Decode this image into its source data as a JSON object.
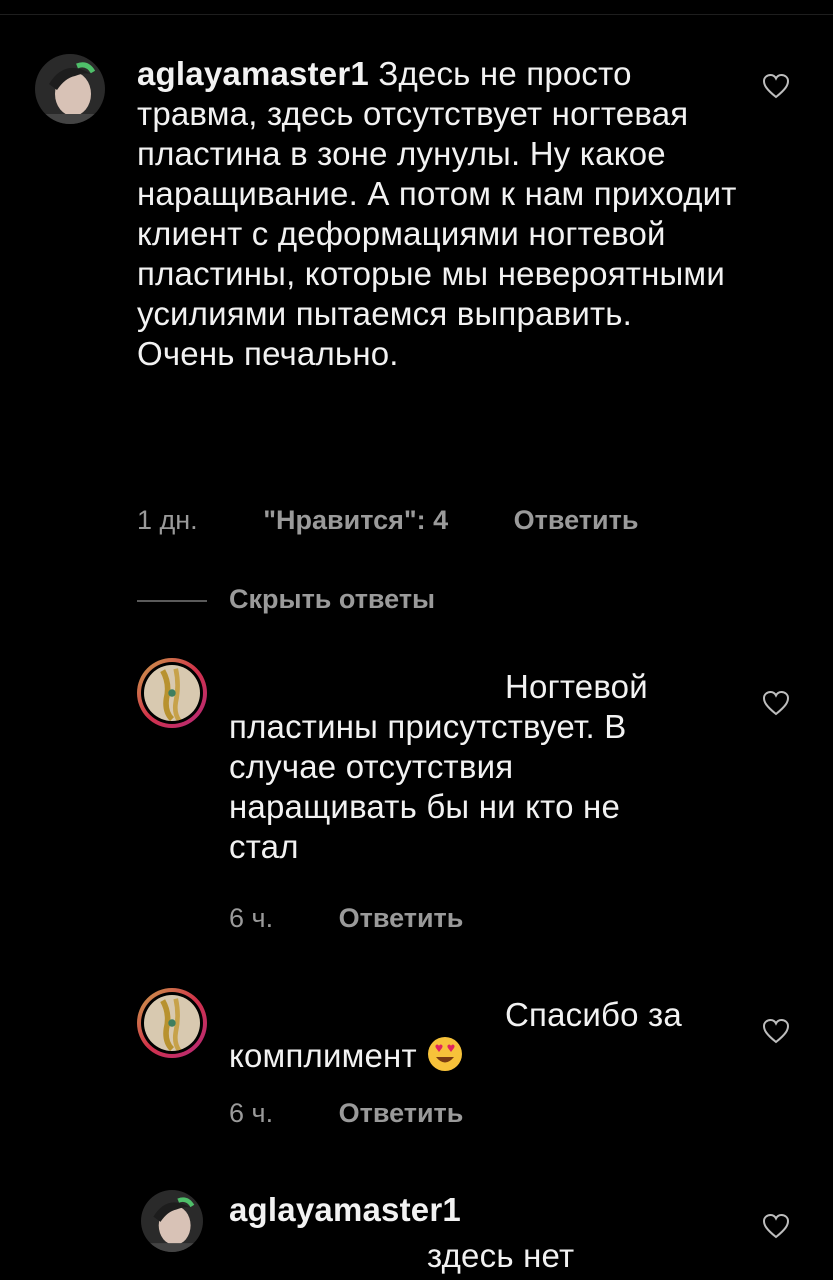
{
  "comments": [
    {
      "username": "aglayamaster1",
      "text": "Здесь не просто травма, здесь отсутствует ногтевая пластина в зоне лунулы. Ну какое наращивание. А потом к нам приходит клиент с деформациями ногтевой пластины, которые мы невероятными усилиями пытаемся выправить. Очень печально.",
      "time": "1 дн.",
      "likes": "\"Нравится\": 4",
      "reply": "Ответить"
    }
  ],
  "hide_replies": "Скрыть ответы",
  "replies": [
    {
      "text_line1": "Ногтевой",
      "text_rest": "пластины присутствует. В случае отсутствия наращивать бы ни кто не стал",
      "time": "6 ч.",
      "reply": "Ответить"
    },
    {
      "text_line1": "Спасибо за",
      "text_rest": "комплимент",
      "emoji": "heart-eyes-emoji",
      "time": "6 ч.",
      "reply": "Ответить"
    },
    {
      "username": "aglayamaster1",
      "text": "здесь нет"
    }
  ],
  "icons": {
    "like": "heart-outline-icon"
  }
}
